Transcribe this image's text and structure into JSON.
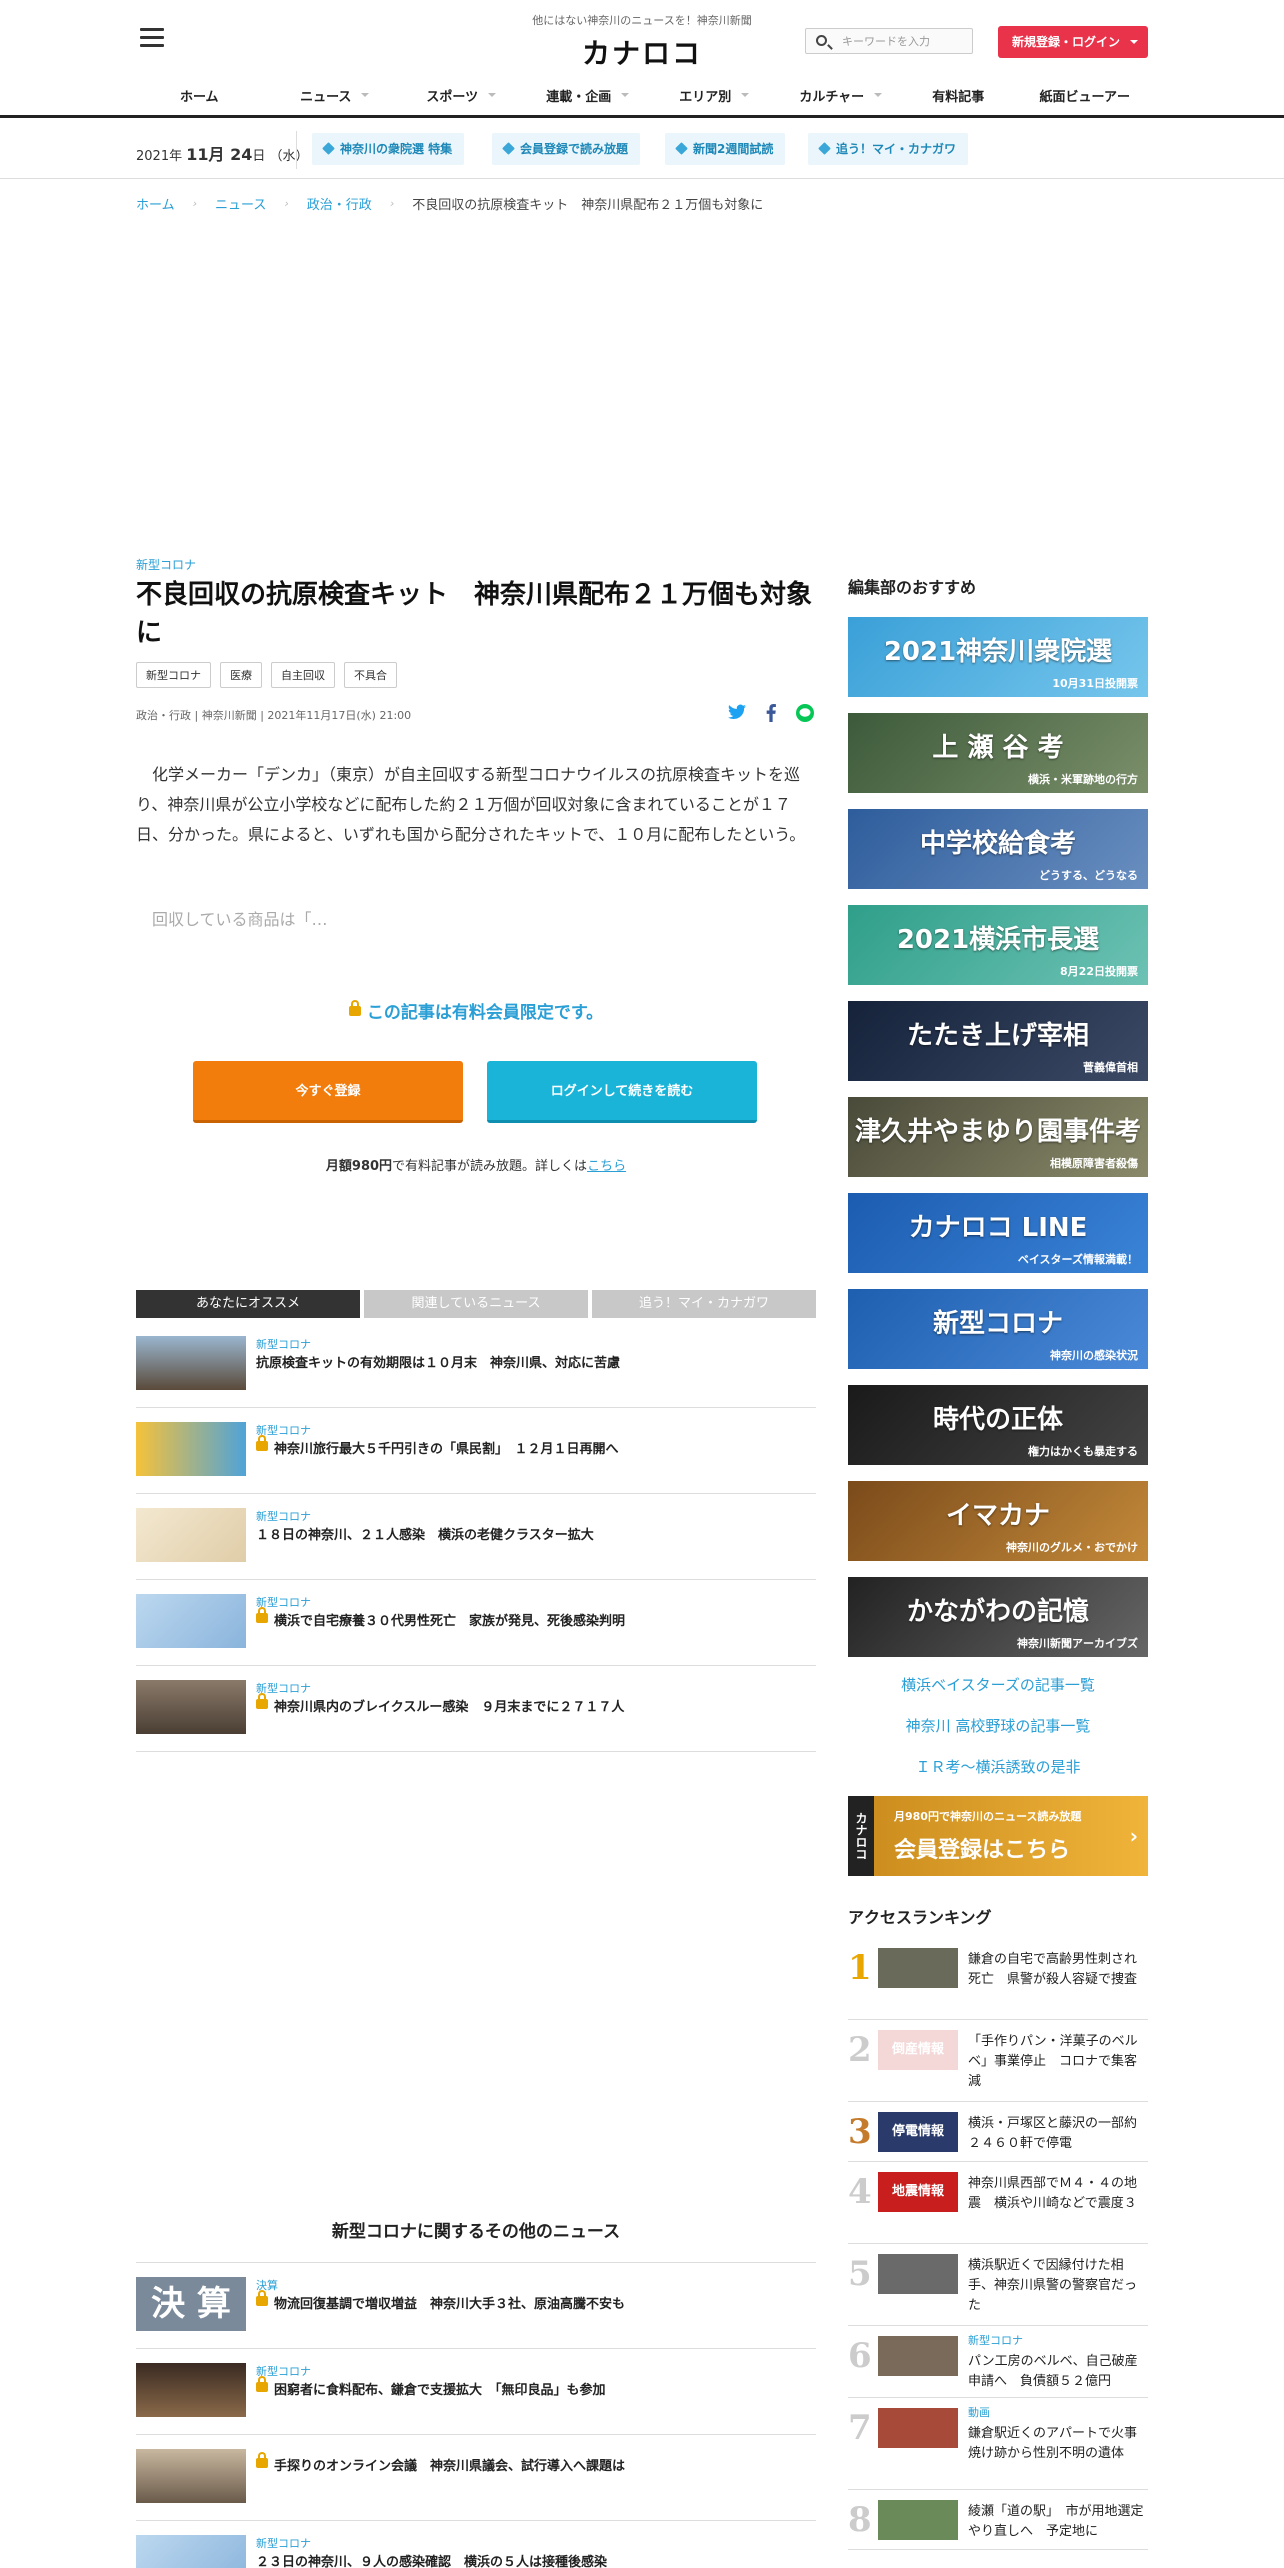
{
  "header": {
    "tagline": "他にはない神奈川のニュースを！神奈川新聞",
    "logo": "カナロコ",
    "search_placeholder": "キーワードを入力",
    "login_label": "新規登録・ログイン",
    "nav": [
      "ホーム",
      "ニュース",
      "スポーツ",
      "連載・企画",
      "エリア別",
      "カルチャー",
      "有料記事",
      "紙面ビューアー"
    ]
  },
  "subbar": {
    "date_year": "2021年",
    "date_md": "11月 24",
    "date_day": "日 （水）",
    "pills": [
      "神奈川の衆院選 特集",
      "会員登録で読み放題",
      "新聞2週間試読",
      "追う！マイ・カナガワ"
    ]
  },
  "breadcrumb": [
    "ホーム",
    "ニュース",
    "政治・行政",
    "不良回収の抗原検査キット　神奈川県配布２１万個も対象に"
  ],
  "article": {
    "category": "新型コロナ",
    "title": "不良回収の抗原検査キット　神奈川県配布２１万個も対象に",
    "tags": [
      "新型コロナ",
      "医療",
      "自主回収",
      "不具合"
    ],
    "meta": "政治・行政 | 神奈川新聞 | 2021年11月17日(水) 21:00",
    "body": "化学メーカー「デンカ」（東京）が自主回収する新型コロナウイルスの抗原検査キットを巡り、神奈川県が公立小学校などに配布した約２１万個が回収対象に含まれていることが１７日、分かった。県によると、いずれも国から配分されたキットで、１０月に配布したという。",
    "teaser": "回収している商品は「…",
    "locked_msg": "この記事は有料会員限定です。",
    "register_btn": "今すぐ登録",
    "login_btn": "ログインして続きを読む",
    "price_pre": "月額980円",
    "price_mid": "で有料記事が読み放題。詳しくは",
    "price_link": "こちら"
  },
  "tabs": [
    "あなたにオススメ",
    "関連しているニュース",
    "追う！マイ・カナガワ"
  ],
  "recommend": [
    {
      "cat": "新型コロナ",
      "title": "抗原検査キットの有効期限は１０月末　神奈川県、対応に苦慮",
      "locked": false
    },
    {
      "cat": "新型コロナ",
      "title": "神奈川旅行最大５千円引きの「県民割」　１２月１日再開へ",
      "locked": true
    },
    {
      "cat": "新型コロナ",
      "title": "１８日の神奈川、２１人感染　横浜の老健クラスター拡大",
      "locked": false
    },
    {
      "cat": "新型コロナ",
      "title": "横浜で自宅療養３０代男性死亡　家族が発見、死後感染判明",
      "locked": true
    },
    {
      "cat": "新型コロナ",
      "title": "神奈川県内のブレイクスルー感染　９月末までに２７１７人",
      "locked": true
    }
  ],
  "more": {
    "heading": "新型コロナに関するその他のニュース",
    "items": [
      {
        "cat": "決算",
        "title": "物流回復基調で増収増益　神奈川大手３社、原油高騰不安も",
        "locked": true,
        "thumb_text": "決 算"
      },
      {
        "cat": "新型コロナ",
        "title": "困窮者に食料配布、鎌倉で支援拡大　「無印良品」も参加",
        "locked": true,
        "thumb_text": ""
      },
      {
        "cat": "",
        "title": "手探りのオンライン会議　神奈川県議会、試行導入へ課題は",
        "locked": true,
        "thumb_text": ""
      },
      {
        "cat": "新型コロナ",
        "title": "２３日の神奈川、９人の感染確認　横浜の５人は接種後感染",
        "locked": false,
        "thumb_text": ""
      }
    ]
  },
  "sidebar": {
    "heading": "編集部のおすすめ",
    "banners": [
      {
        "t": "2021神奈川衆院選",
        "s": "10月31日投開票",
        "c1": "#3aa0d8",
        "c2": "#76c6ec"
      },
      {
        "t": "上 瀬 谷 考",
        "s": "横浜・米軍跡地の行方",
        "c1": "#3c5a3a",
        "c2": "#7b8f6a"
      },
      {
        "t": "中学校給食考",
        "s": "どうする、どうなる",
        "c1": "#2e5d9c",
        "c2": "#6a8fc0"
      },
      {
        "t": "2021横浜市長選",
        "s": "8月22日投開票",
        "c1": "#2f9f8a",
        "c2": "#6dc2b4"
      },
      {
        "t": "たたき上げ宰相",
        "s": "菅義偉首相",
        "c1": "#15223a",
        "c2": "#3c4a66"
      },
      {
        "t": "津久井やまゆり園事件考",
        "s": "相模原障害者殺傷",
        "c1": "#4a4a3a",
        "c2": "#8a8a6a"
      },
      {
        "t": "カナロコ LINE",
        "s": "ベイスターズ情報満載！",
        "c1": "#1c5cb0",
        "c2": "#3a84d8"
      },
      {
        "t": "新型コロナ",
        "s": "神奈川の感染状況",
        "c1": "#1f5fb0",
        "c2": "#4a8ad8"
      },
      {
        "t": "時代の正体",
        "s": "権力はかくも暴走する",
        "c1": "#1a1a1a",
        "c2": "#444"
      },
      {
        "t": "イマカナ",
        "s": "神奈川のグルメ・おでかけ",
        "c1": "#7a4a1a",
        "c2": "#c48a3a"
      },
      {
        "t": "かながわの記憶",
        "s": "神奈川新聞アーカイブズ",
        "c1": "#222",
        "c2": "#666"
      }
    ],
    "links": [
      "横浜ベイスターズの記事一覧",
      "神奈川 高校野球の記事一覧",
      "ＩＲ考～横浜誘致の是非"
    ],
    "member_banner": {
      "t": "会員登録はこちら",
      "s": "月980円で神奈川のニュース読み放題"
    },
    "ranking_heading": "アクセスランキング",
    "ranking": [
      {
        "n": "1",
        "cat": "",
        "title": "鎌倉の自宅で高齢男性刺され死亡　県警が殺人容疑で捜査",
        "thumb": "",
        "h": 82
      },
      {
        "n": "2",
        "cat": "",
        "title": "「手作りパン・洋菓子のベルベ」事業停止　コロナで集客減",
        "thumb": "倒産情報",
        "h": 82
      },
      {
        "n": "3",
        "cat": "",
        "title": "横浜・戸塚区と藤沢の一部約２４６０軒で停電",
        "thumb": "停電情報",
        "h": 60
      },
      {
        "n": "4",
        "cat": "",
        "title": "神奈川県西部でＭ４・４の地震　横浜や川崎などで震度３",
        "thumb": "地震情報",
        "h": 82
      },
      {
        "n": "5",
        "cat": "",
        "title": "横浜駅近くで因縁付けた相手、神奈川県警の警察官だった",
        "thumb": "",
        "h": 82
      },
      {
        "n": "6",
        "cat": "新型コロナ",
        "title": "パン工房のベルベ、自己破産申請へ　負債額５２億円",
        "thumb": "",
        "h": 72
      },
      {
        "n": "7",
        "cat": "動画",
        "title": "鎌倉駅近くのアパートで火事　焼け跡から性別不明の遺体",
        "thumb": "",
        "h": 92
      },
      {
        "n": "8",
        "cat": "",
        "title": "綾瀬「道の駅」　市が用地選定やり直しへ　予定地に",
        "thumb": "",
        "h": 60
      }
    ]
  },
  "colors": {
    "accent": "#2a9fd6",
    "login": "#e8334b",
    "register": "#f27d0c",
    "login_read": "#1ab4d9"
  }
}
